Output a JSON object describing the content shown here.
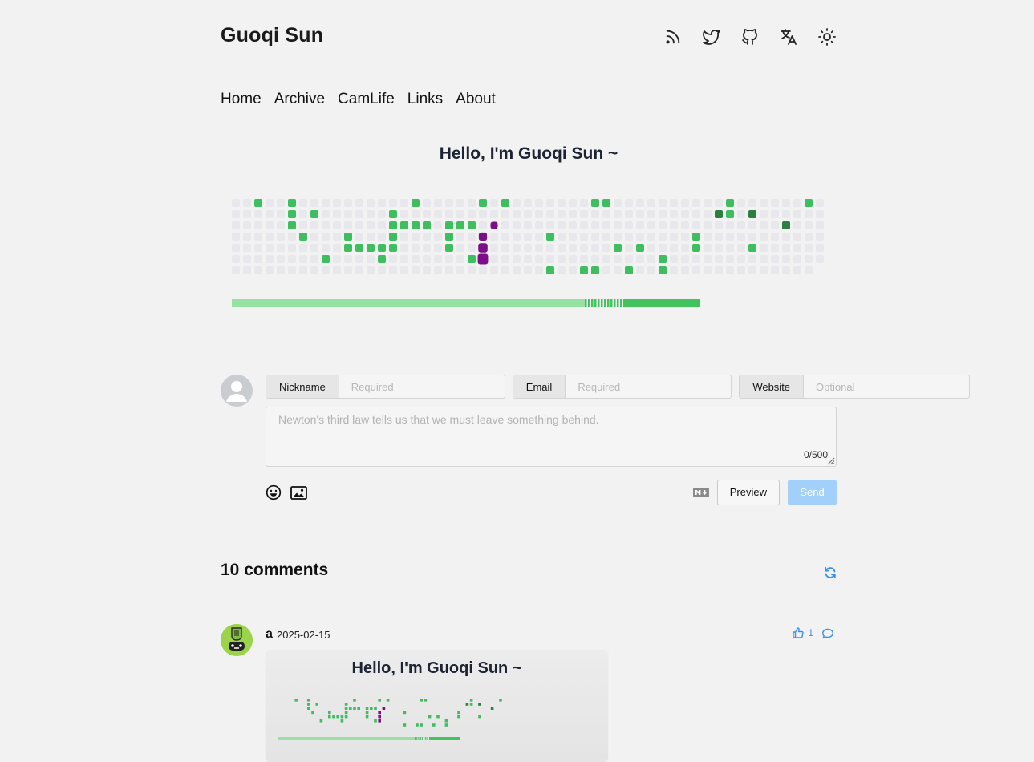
{
  "header": {
    "title": "Guoqi Sun",
    "icons": [
      "rss-icon",
      "twitter-icon",
      "github-icon",
      "translate-icon",
      "sun-icon"
    ]
  },
  "nav": [
    "Home",
    "Archive",
    "CamLife",
    "Links",
    "About"
  ],
  "hero": {
    "heading": "Hello, I'm Guoqi Sun ~"
  },
  "form": {
    "nickname_label": "Nickname",
    "nickname_placeholder": "Required",
    "email_label": "Email",
    "email_placeholder": "Required",
    "website_label": "Website",
    "website_placeholder": "Optional",
    "comment_placeholder": "Newton's third law tells us that we must leave something behind.",
    "counter": "0/500",
    "preview_label": "Preview",
    "send_label": "Send"
  },
  "comments": {
    "count_label": "10 comments",
    "items": [
      {
        "nick": "a",
        "date": "2025-02-15",
        "likes": "1",
        "card_heading": "Hello, I'm Guoqi Sun ~"
      }
    ]
  },
  "colors": {
    "cell_empty": "#e8e8ec",
    "green_light": "#3fbe5f",
    "green_dark": "#2b7f3f",
    "snake_purple": "#7b0f8a",
    "bar_light": "#96e2a2",
    "bar_dark": "#43c35d",
    "accent_blue": "#3b8fe8"
  }
}
